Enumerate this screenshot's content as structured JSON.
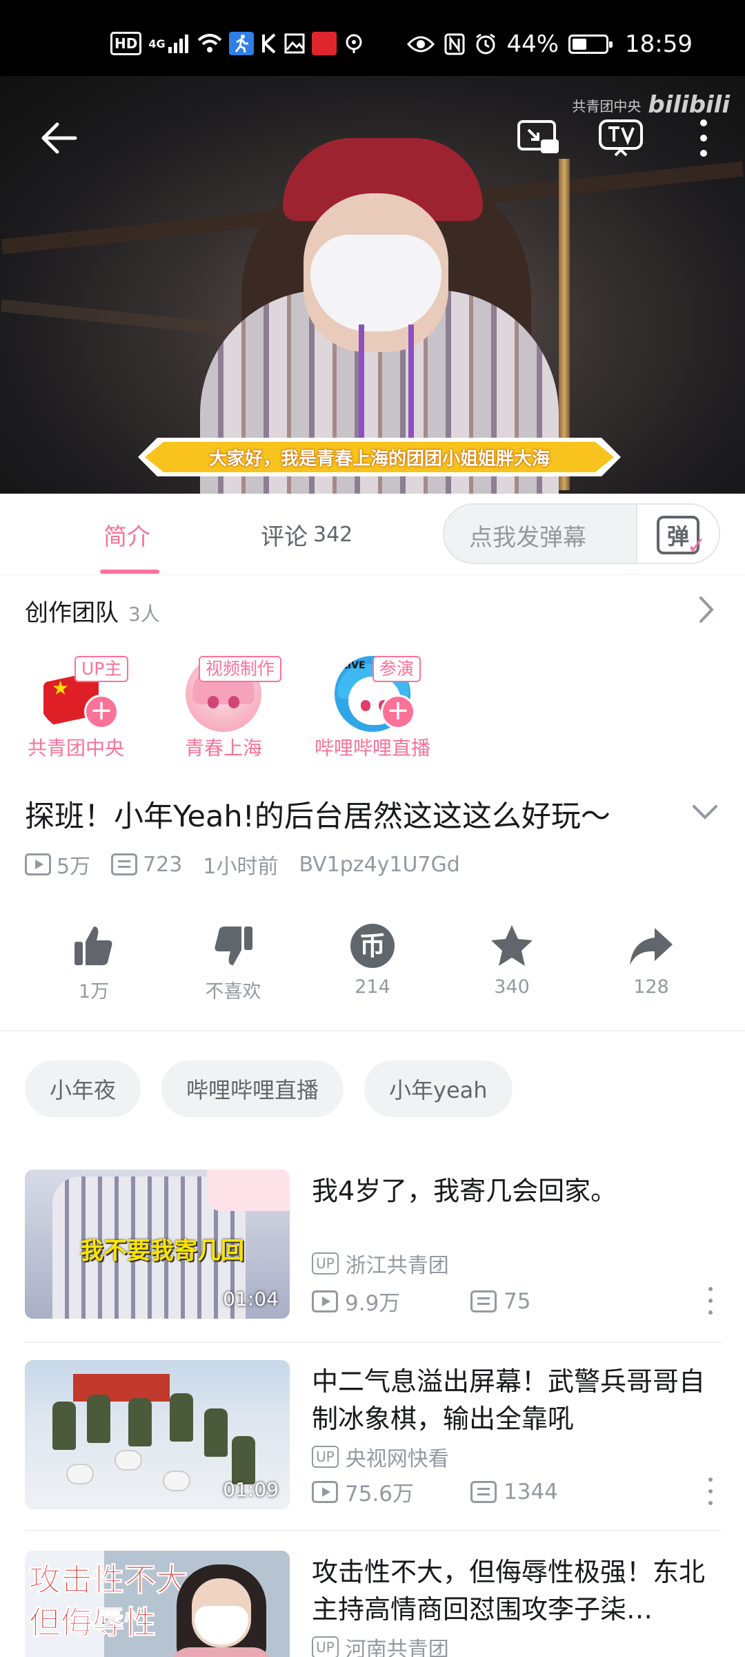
{
  "status_bar": {
    "left_icons": [
      "hd-icon",
      "4g-signal-icon",
      "wifi-icon",
      "running-app-icon",
      "k-icon",
      "image-icon",
      "red-app-icon",
      "pinwheel-icon"
    ],
    "hd": "HD",
    "network": "4G",
    "battery": "44%",
    "battery_level": 0.44,
    "time": "18:59",
    "right_icons": [
      "eye-comfort-icon",
      "nfc-icon",
      "alarm-icon",
      "battery-icon"
    ]
  },
  "video": {
    "watermark_channel": "共青团中央",
    "watermark_logo": "bilibili",
    "subtitle": "大家好，我是青春上海的团团小姐姐胖大海"
  },
  "tabs": {
    "intro": "简介",
    "comments": "评论",
    "comment_count": "342",
    "danmaku_placeholder": "点我发弹幕",
    "danmaku_glyph": "弹"
  },
  "team": {
    "title": "创作团队",
    "count": "3人",
    "members": [
      {
        "role": "UP主",
        "name": "共青团中央"
      },
      {
        "role": "视频制作",
        "name": "青春上海"
      },
      {
        "role": "参演",
        "name": "哔哩哔哩直播"
      }
    ],
    "live_tag": "LIVE"
  },
  "video_info": {
    "title": "探班！小年Yeah!的后台居然这这这么好玩～",
    "views": "5万",
    "danmaku": "723",
    "time": "1小时前",
    "bvid": "BV1pz4y1U7Gd"
  },
  "actions": {
    "like": "1万",
    "dislike": "不喜欢",
    "coin": "214",
    "favorite": "340",
    "share": "128",
    "coin_glyph": "币"
  },
  "tags": [
    "小年夜",
    "哔哩哔哩直播",
    "小年yeah"
  ],
  "related": [
    {
      "title": "我4岁了，我寄几会回家。",
      "up_badge": "UP",
      "up": "浙江共青团",
      "views": "9.9万",
      "danmaku": "75",
      "duration": "01:04",
      "thumb_text": "我不要我寄几回"
    },
    {
      "title": "中二气息溢出屏幕！武警兵哥哥自制冰象棋，输出全靠吼",
      "up_badge": "UP",
      "up": "央视网快看",
      "views": "75.6万",
      "danmaku": "1344",
      "duration": "01:09"
    },
    {
      "title": "攻击性不大，但侮辱性极强！东北主持高情商回怼围攻李子柒…",
      "up_badge": "UP",
      "up": "河南共青团",
      "thumb_text_1": "攻击性不大",
      "thumb_text_2": "但侮辱性"
    }
  ],
  "colors": {
    "accent": "#fb7299",
    "text": "#18191c",
    "secondary": "#9499a0",
    "subtitle_bg": "#f7c31c"
  }
}
